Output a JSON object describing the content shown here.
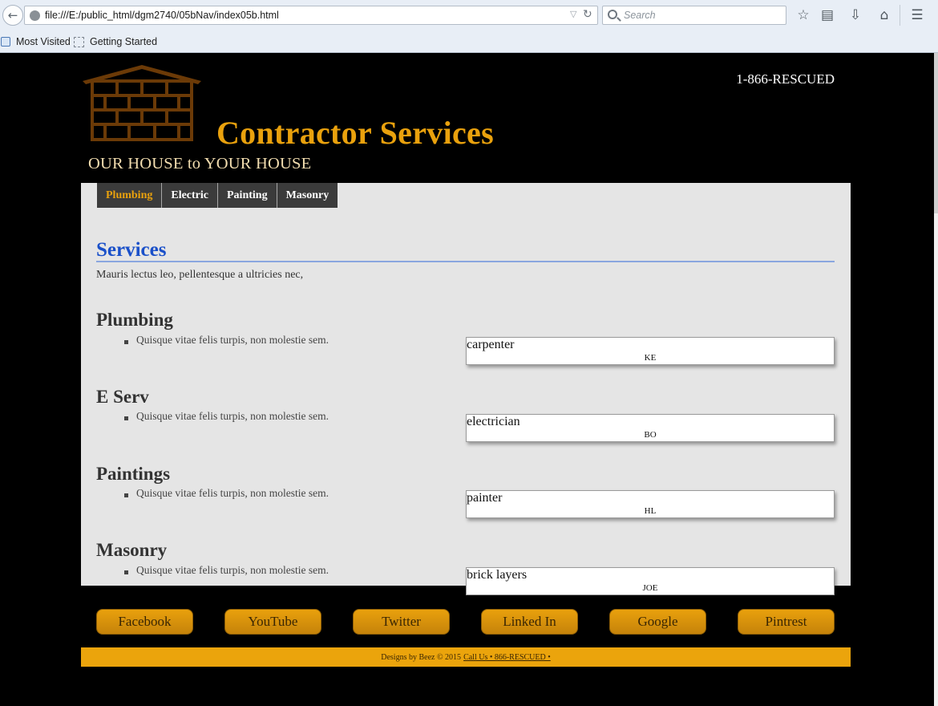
{
  "browser": {
    "url": "file:///E:/public_html/dgm2740/05bNav/index05b.html",
    "search_placeholder": "Search",
    "bookmarks": [
      "Most Visited",
      "Getting Started"
    ]
  },
  "header": {
    "phone": "1-866-RESCUED",
    "title": "Contractor Services",
    "tagline": "OUR HOUSE to YOUR HOUSE"
  },
  "nav": {
    "items": [
      "Plumbing",
      "Electric",
      "Painting",
      "Masonry"
    ],
    "active": "Plumbing"
  },
  "services": {
    "heading": "Services",
    "intro": "Mauris lectus leo, pellentesque a ultricies nec,",
    "sections": [
      {
        "heading": "Plumbing",
        "bullet": "Quisque vitae felis turpis, non molestie sem.",
        "card_title": "carpenter",
        "card_name": "KE"
      },
      {
        "heading": "E Serv",
        "bullet": "Quisque vitae felis turpis, non molestie sem.",
        "card_title": "electrician",
        "card_name": "BO"
      },
      {
        "heading": "Paintings",
        "bullet": "Quisque vitae felis turpis, non molestie sem.",
        "card_title": "painter",
        "card_name": "HL"
      },
      {
        "heading": "Masonry",
        "bullet": "Quisque vitae felis turpis, non molestie sem.",
        "card_title": "brick layers",
        "card_name": "JOE"
      }
    ]
  },
  "social": [
    "Facebook",
    "YouTube",
    "Twitter",
    "Linked In",
    "Google",
    "Pintrest"
  ],
  "footer": {
    "text": "Designs by Beez © 2015",
    "link": "Call Us • 866-RESCUED •"
  },
  "colors": {
    "accent": "#e9a10d",
    "heading_blue": "#1a50c9",
    "nav_bg": "#3b3b3b",
    "content_bg": "#e5e5e5"
  }
}
